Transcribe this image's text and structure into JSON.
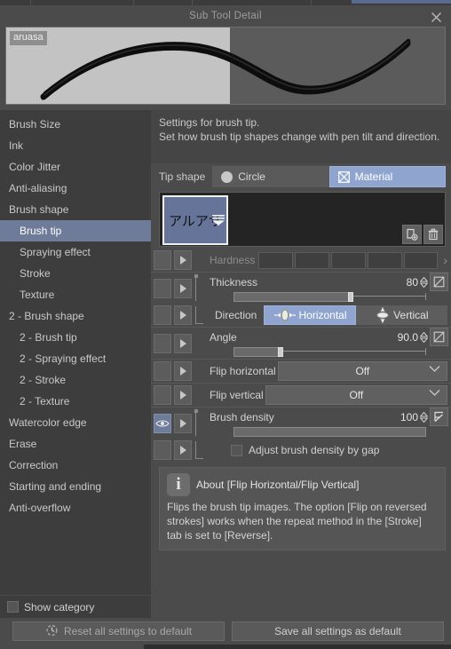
{
  "window": {
    "title": "Sub Tool Detail",
    "close_icon": "close-icon"
  },
  "preview": {
    "badge_label": "aruasa"
  },
  "sidebar": {
    "items": [
      {
        "label": "Brush Size",
        "sub": false,
        "selected": false
      },
      {
        "label": "Ink",
        "sub": false,
        "selected": false
      },
      {
        "label": "Color Jitter",
        "sub": false,
        "selected": false
      },
      {
        "label": "Anti-aliasing",
        "sub": false,
        "selected": false
      },
      {
        "label": "Brush shape",
        "sub": false,
        "selected": false
      },
      {
        "label": "Brush tip",
        "sub": true,
        "selected": true
      },
      {
        "label": "Spraying effect",
        "sub": true,
        "selected": false
      },
      {
        "label": "Stroke",
        "sub": true,
        "selected": false
      },
      {
        "label": "Texture",
        "sub": true,
        "selected": false
      },
      {
        "label": "2 - Brush shape",
        "sub": false,
        "selected": false
      },
      {
        "label": "2 - Brush tip",
        "sub": true,
        "selected": false
      },
      {
        "label": "2 - Spraying effect",
        "sub": true,
        "selected": false
      },
      {
        "label": "2 - Stroke",
        "sub": true,
        "selected": false
      },
      {
        "label": "2 - Texture",
        "sub": true,
        "selected": false
      },
      {
        "label": "Watercolor edge",
        "sub": false,
        "selected": false
      },
      {
        "label": "Erase",
        "sub": false,
        "selected": false
      },
      {
        "label": "Correction",
        "sub": false,
        "selected": false
      },
      {
        "label": "Starting and ending",
        "sub": false,
        "selected": false
      },
      {
        "label": "Anti-overflow",
        "sub": false,
        "selected": false
      }
    ],
    "show_category_label": "Show category",
    "show_category_checked": false
  },
  "description": {
    "line1": "Settings for brush tip.",
    "line2": "Set how brush tip shapes change with pen tilt and direction."
  },
  "tip_shape": {
    "label": "Tip shape",
    "options": [
      {
        "label": "Circle",
        "icon": "circle-icon",
        "active": false
      },
      {
        "label": "Material",
        "icon": "material-icon",
        "active": true
      }
    ]
  },
  "material_box": {
    "thumbnail_glyph": "アルアサ",
    "add_button_icon": "duplicate-add-icon",
    "delete_button_icon": "trash-icon"
  },
  "settings": {
    "hardness": {
      "label": "Hardness",
      "enabled": false,
      "swatch_count": 5,
      "expand_icon": "chevron-right-icon"
    },
    "thickness": {
      "label": "Thickness",
      "value": "80",
      "slider_percent": 62,
      "side_button_icon": "no-effect-icon"
    },
    "direction": {
      "label": "Direction",
      "options": [
        {
          "label": "Horizontal",
          "icon": "horizontal-icon",
          "active": true
        },
        {
          "label": "Vertical",
          "icon": "vertical-icon",
          "active": false
        }
      ]
    },
    "angle": {
      "label": "Angle",
      "value": "90.0",
      "slider_percent": 26,
      "side_button_icon": "no-effect-icon"
    },
    "flip_horizontal": {
      "label": "Flip horizontal",
      "value": "Off",
      "chevron_icon": "chevron-down-icon"
    },
    "flip_vertical": {
      "label": "Flip vertical",
      "value": "Off",
      "chevron_icon": "chevron-down-icon"
    },
    "brush_density": {
      "label": "Brush density",
      "value": "100",
      "slider_percent": 100,
      "eye_icon": "eye-icon",
      "side_button_icon": "curve-graph-icon"
    },
    "adjust_by_gap": {
      "label": "Adjust brush density by gap",
      "checked": false
    }
  },
  "about": {
    "info_icon": "info-icon",
    "heading": "About [Flip Horizontal/Flip Vertical]",
    "body": "Flips the brush tip images. The option [Flip on reversed strokes] works when the repeat method in the [Stroke] tab is set to [Reverse]."
  },
  "footer": {
    "reset_label": "Reset all settings to default",
    "reset_icon": "reset-clock-icon",
    "save_label": "Save all settings as default"
  },
  "colors": {
    "accent": "#8fa5cf",
    "selection": "#6e7b99",
    "panel": "#4b4b4b",
    "sidebar": "#3d3d3d",
    "thumb_bg": "#66749a"
  }
}
